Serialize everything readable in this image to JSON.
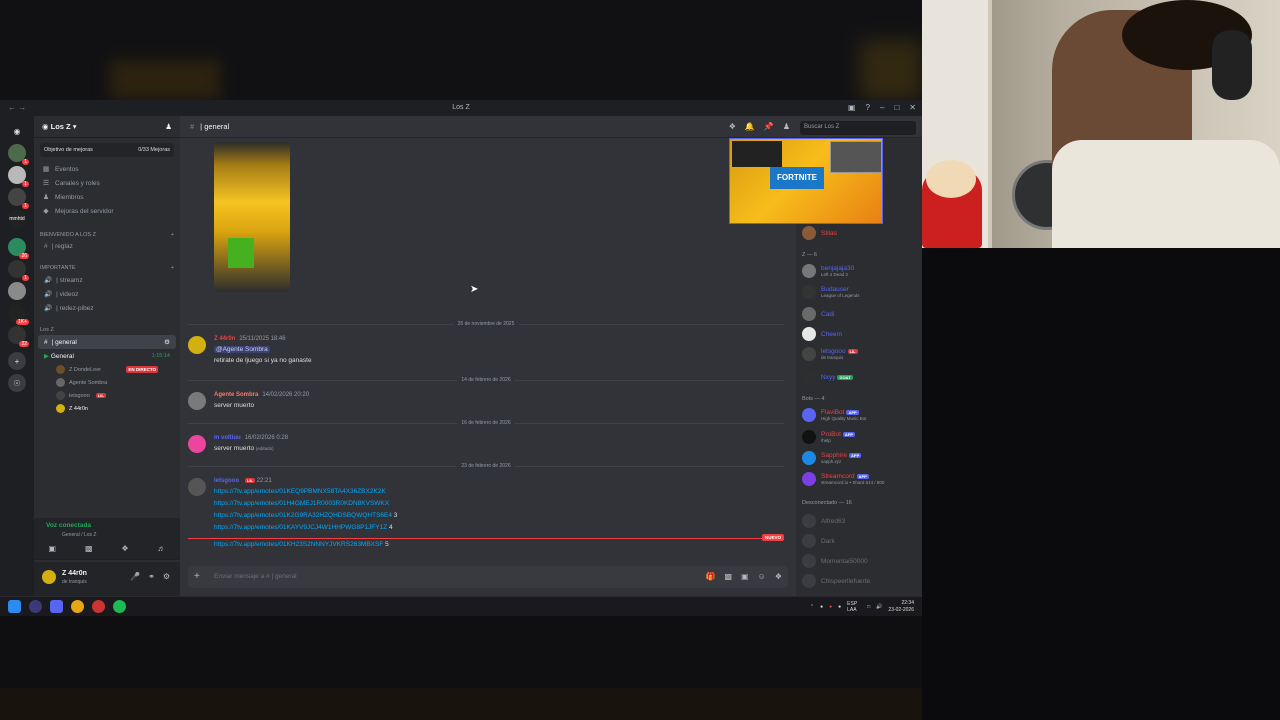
{
  "window": {
    "title": "Los Z"
  },
  "guilds": [
    {
      "name": "discord-home",
      "badge": ""
    },
    {
      "name": "guild-1",
      "badge": "1"
    },
    {
      "name": "guild-2",
      "badge": "1"
    },
    {
      "name": "guild-3",
      "badge": "1"
    },
    {
      "name": "guild-4",
      "label": "mmhtd",
      "badge": ""
    },
    {
      "name": "guild-5",
      "badge": "26"
    },
    {
      "name": "guild-6",
      "badge": "1"
    },
    {
      "name": "guild-7",
      "badge": "1K+"
    },
    {
      "name": "guild-8",
      "badge": "22"
    }
  ],
  "sidebar": {
    "server_name": "Los Z",
    "boost_label": "Objetivo de mejoras",
    "boost_value": "0/33 Mejoras",
    "items": [
      {
        "label": "Eventos",
        "icon": "calendar-icon"
      },
      {
        "label": "Canales y roles",
        "icon": "list-icon"
      },
      {
        "label": "Miembros",
        "icon": "members-icon"
      },
      {
        "label": "Mejoras del servidor",
        "icon": "boost-icon"
      }
    ],
    "categories": [
      {
        "label": "BIENVENIDO A LOS Z",
        "channels": [
          "| reglaz"
        ]
      },
      {
        "label": "IMPORTANTE",
        "channels": [
          "| streamz",
          "| videoz",
          "| redez-pibez"
        ]
      },
      {
        "label": "Los Z",
        "channels": [
          "| general"
        ]
      }
    ],
    "voice_channel": {
      "name": "General",
      "time": "1:15:14"
    },
    "voice_users": [
      {
        "name": "Z DondeLeer",
        "badge": "EN DIRECTO"
      },
      {
        "name": "Agente Sombra",
        "badge": ""
      },
      {
        "name": "letsgooo",
        "badge": "LIL"
      },
      {
        "name": "Z 44r0n",
        "badge": ""
      }
    ]
  },
  "voice_panel": {
    "status": "Voz conectada",
    "location": "General / Los Z"
  },
  "user_panel": {
    "name": "Z 44r0n",
    "status": "de tranquis"
  },
  "chat": {
    "channel": "| general",
    "search_placeholder": "Buscar Los Z",
    "composer_placeholder": "Enviar mensaje a # | general",
    "dividers": [
      "25 de noviembre de 2025",
      "14 de febrero de 2026",
      "16 de febrero de 2026",
      "23 de febrero de 2026"
    ],
    "messages": [
      {
        "user": "Z 44r0n",
        "time": "25/11/2025 18:46",
        "mention": "@Agente Sombra",
        "text": "retirate de ljuego si ya no ganaste",
        "color": "#ed4245"
      },
      {
        "user": "Agente Sombra",
        "time": "14/02/2026 20:20",
        "text": "server muerto",
        "color": "#f47b67"
      },
      {
        "user": "m voltiuu",
        "time": "16/02/2026 0:28",
        "text": "server muerto",
        "edited": "(editado)",
        "color": "#5865f2"
      },
      {
        "user": "letsgooo",
        "tag": "LIL",
        "time": "22:21",
        "color": "#5865f2",
        "links": [
          {
            "url": "https://7tv.app/emotes/01KEQ9PBMNX58TA4X36ZBX2K2K",
            "n": ""
          },
          {
            "url": "https://7tv.app/emotes/01H4GMEJ1R0003R0KDN8KVSWKX",
            "n": ""
          },
          {
            "url": "https://7tv.app/emotes/01K2G9RA32HZQHDSBQWQHTS6E4",
            "n": "3"
          },
          {
            "url": "https://7tv.app/emotes/01KAYV9JCJ4W1HHPWG8P1JFY1Z",
            "n": "4"
          },
          {
            "url": "https://7tv.app/emotes/01KH23S2NNNYJVKRS263MBXSF",
            "n": "5"
          }
        ]
      }
    ],
    "new_label": "NUEVO"
  },
  "members": {
    "top_user": "Stilas",
    "group_z": "Z — 6",
    "z_members": [
      {
        "name": "benjajaja30",
        "status": "Left 4 Dead 2",
        "color": "#5865f2"
      },
      {
        "name": "Budauser",
        "status": "League of Legends",
        "color": "#5865f2"
      },
      {
        "name": "Cadi",
        "status": "",
        "color": "#5865f2"
      },
      {
        "name": "Cheem",
        "status": "",
        "color": "#5865f2"
      },
      {
        "name": "letsgooo",
        "tag": "LIL",
        "status": "de tranquis",
        "color": "#5865f2"
      },
      {
        "name": "Nxyy",
        "tag": "GOAT",
        "status": "",
        "color": "#5865f2"
      }
    ],
    "group_bots": "Bots — 4",
    "bots": [
      {
        "name": "FlaviBot",
        "status": "High Quality Music Bot",
        "color": "#ed4245"
      },
      {
        "name": "ProBot",
        "status": "/help",
        "color": "#ed4245"
      },
      {
        "name": "Sapphire",
        "status": "sapph.xyz",
        "color": "#ed4245"
      },
      {
        "name": "Streamcord",
        "status": "streamcord.io • Shard 614 / 800",
        "color": "#ed4245"
      }
    ],
    "group_offline": "Desconectado — 16",
    "offline": [
      "Alfred63",
      "Dark",
      "Momentai50000",
      "Chispeerllefuerte"
    ]
  },
  "pip": {
    "game": "FORTNITE"
  },
  "taskbar": {
    "lang": "ESP LAA",
    "time": "22:34",
    "date": "23-02-2026"
  },
  "colors": {
    "accent": "#5865f2",
    "online": "#23a55a",
    "danger": "#f23f43"
  }
}
